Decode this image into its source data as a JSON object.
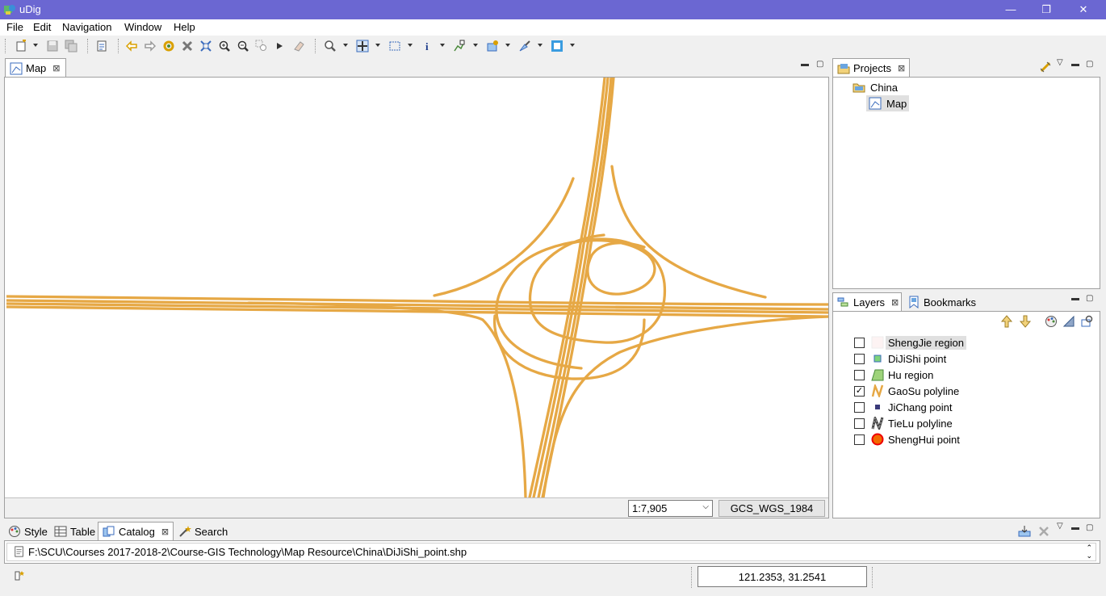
{
  "window": {
    "title": "uDig",
    "minimize": "—",
    "restore": "❐",
    "close": "✕"
  },
  "menu": [
    "File",
    "Edit",
    "Navigation",
    "Window",
    "Help"
  ],
  "map_view": {
    "tab_label": "Map",
    "scale": "1:7,905",
    "crs": "GCS_WGS_1984",
    "road_color": "#e6a845"
  },
  "projects": {
    "tab_label": "Projects",
    "project": "China",
    "map": "Map"
  },
  "layers_panel": {
    "tab_label": "Layers",
    "bookmarks_label": "Bookmarks",
    "layers": [
      {
        "name": "ShengJie region",
        "checked": false,
        "icon": "region-empty-icon"
      },
      {
        "name": "DiJiShi point",
        "checked": false,
        "icon": "point-green-icon"
      },
      {
        "name": "Hu region",
        "checked": false,
        "icon": "region-green-icon"
      },
      {
        "name": "GaoSu polyline",
        "checked": true,
        "icon": "polyline-orange-icon"
      },
      {
        "name": "JiChang point",
        "checked": false,
        "icon": "point-navy-icon"
      },
      {
        "name": "TieLu polyline",
        "checked": false,
        "icon": "polyline-gray-icon"
      },
      {
        "name": "ShengHui point",
        "checked": false,
        "icon": "point-red-icon"
      }
    ]
  },
  "bottom_panel": {
    "tabs": [
      "Style",
      "Table",
      "Catalog",
      "Search"
    ],
    "active_tab": "Catalog",
    "path": "F:\\SCU\\Courses 2017-2018-2\\Course-GIS Technology\\Map Resource\\China\\DiJiShi_point.shp"
  },
  "status": {
    "coordinates": "121.2353, 31.2541"
  }
}
